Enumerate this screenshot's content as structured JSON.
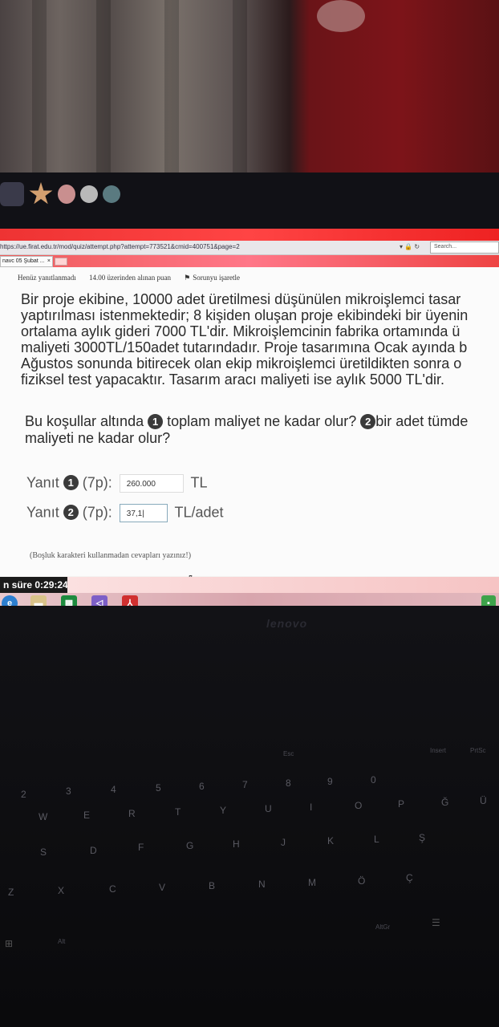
{
  "browser": {
    "url": "https://ue.firat.edu.tr/mod/quiz/attempt.php?attempt=773521&cmid=400751&page=2",
    "search_placeholder": "Search...",
    "tab_label": "navc 05 Şubat ...",
    "tab_close": "×"
  },
  "quiz": {
    "status": "Henüz yanıtlanmadı",
    "points": "14.00 üzerinden alınan puan",
    "flag": "Sorunyu işaretle",
    "question_lines": [
      "Bir proje ekibine, 10000 adet üretilmesi düşünülen mikroişlemci tasar",
      "yaptırılması istenmektedir; 8 kişiden oluşan proje ekibindeki bir üyenin",
      "ortalama aylık gideri 7000 TL'dir. Mikroişlemcinin fabrika ortamında ü",
      "maliyeti 3000TL/150adet tutarındadır. Proje tasarımına Ocak ayında b",
      "Ağustos sonunda bitirecek olan ekip mikroişlemci üretildikten sonra o",
      "fiziksel test yapacaktır. Tasarım aracı maliyeti ise aylık 5000 TL'dir."
    ],
    "sub_prefix": "Bu koşullar altında",
    "sub_num1": "1",
    "sub_part1": "toplam maliyet ne kadar olur?",
    "sub_num2": "2",
    "sub_part2": "bir adet tümde",
    "sub_line2": "maliyeti ne kadar olur?",
    "answer1": {
      "label": "Yanıt",
      "num": "1",
      "points": "(7p):",
      "value": "260.000",
      "unit": "TL"
    },
    "answer2": {
      "label": "Yanıt",
      "num": "2",
      "points": "(7p):",
      "value": "37,1|",
      "unit": "TL/adet"
    },
    "note": "(Boşluk karakteri kullanmadan cevapları yazınız!)"
  },
  "timer": "n süre 0:29:24",
  "laptop_brand": "lenovo",
  "keyboard": {
    "row_numbers": [
      "2",
      "3",
      "4",
      "5",
      "6",
      "7",
      "8",
      "9",
      "0"
    ],
    "row_q": [
      "W",
      "E",
      "R",
      "T",
      "Y",
      "U",
      "I",
      "O",
      "P",
      "Ğ",
      "Ü"
    ],
    "row_a": [
      "S",
      "D",
      "F",
      "G",
      "H",
      "J",
      "K",
      "L",
      "Ş"
    ],
    "row_z": [
      "Z",
      "X",
      "C",
      "V",
      "B",
      "N",
      "M",
      "Ö",
      "Ç"
    ],
    "fn_keys": [
      "Esc",
      "Insert",
      "PrtSc"
    ],
    "bottom": [
      "Alt",
      "AltGr"
    ]
  },
  "colors": {
    "browser_red": "#ee3333",
    "screen_bg": "#fbfbfb",
    "text": "#2b2b2b",
    "badge": "#3a3a3a"
  }
}
